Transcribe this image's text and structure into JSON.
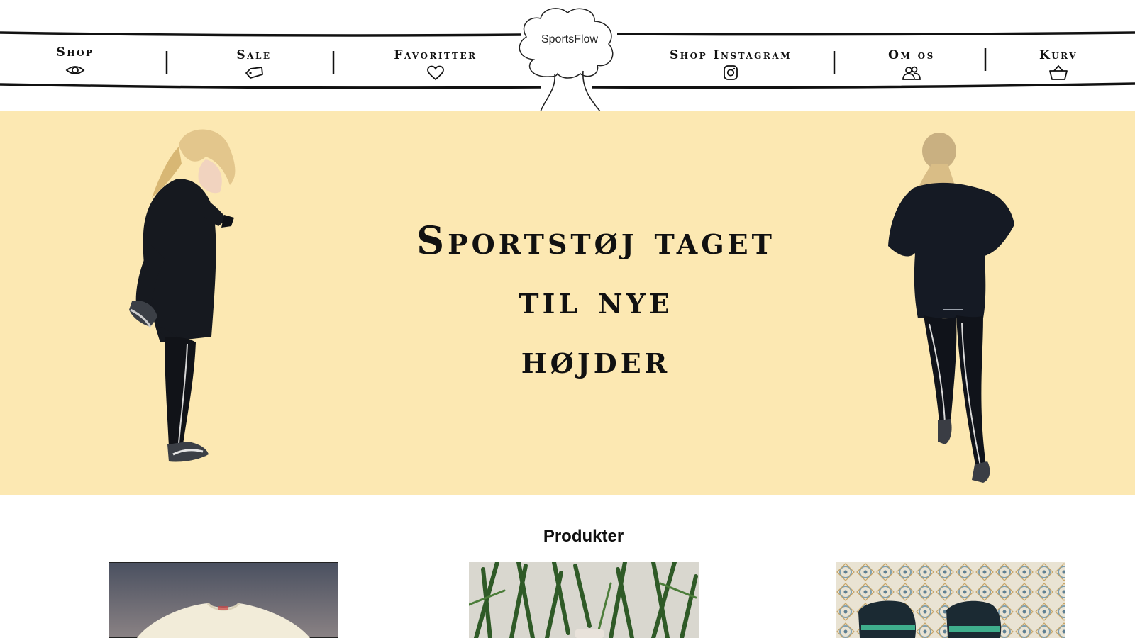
{
  "logo": {
    "text": "SportsFlow"
  },
  "nav": {
    "items": [
      {
        "label": "Shop",
        "icon": "eye-icon"
      },
      {
        "label": "Sale",
        "icon": "tag-icon"
      },
      {
        "label": "Favoritter",
        "icon": "heart-icon"
      },
      {
        "label": "Shop Instagram",
        "icon": "instagram-icon"
      },
      {
        "label": "Om os",
        "icon": "users-icon"
      },
      {
        "label": "Kurv",
        "icon": "basket-icon"
      }
    ]
  },
  "hero": {
    "background": "#fce8b2",
    "title_lines": [
      "Sportstøj taget",
      "til nye",
      "højder"
    ]
  },
  "products": {
    "heading": "Produkter",
    "cards": [
      {
        "image": "sweatshirt-photo"
      },
      {
        "image": "plant-photo"
      },
      {
        "image": "socks-photo"
      }
    ]
  }
}
